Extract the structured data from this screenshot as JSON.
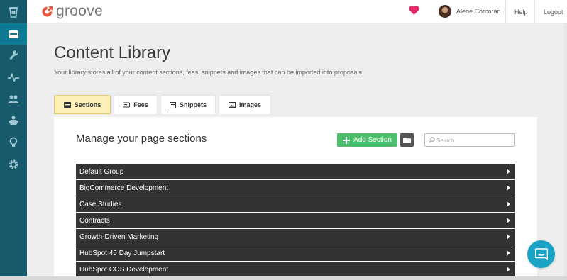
{
  "brand": {
    "name": "groove",
    "accent": "#e8573e",
    "sidebar_color": "#175a6b"
  },
  "sidebar": {
    "items": [
      {
        "icon": "cup-icon"
      },
      {
        "icon": "library-icon",
        "active": true
      },
      {
        "icon": "wrench-icon"
      },
      {
        "icon": "pulse-icon"
      },
      {
        "icon": "people-icon"
      },
      {
        "icon": "handshake-icon"
      },
      {
        "icon": "lightbulb-icon"
      },
      {
        "icon": "gear-icon"
      }
    ]
  },
  "topbar": {
    "user_name": "Alene Corcoran",
    "help": "Help",
    "logout": "Logout"
  },
  "page": {
    "title": "Content Library",
    "subtitle": "Your library stores all of your content sections, fees, snippets and images that can be imported into proposals."
  },
  "tabs": [
    {
      "label": "Sections",
      "icon": "sections-icon",
      "active": true
    },
    {
      "label": "Fees",
      "icon": "fees-icon"
    },
    {
      "label": "Snippets",
      "icon": "snippets-icon"
    },
    {
      "label": "Images",
      "icon": "images-icon"
    }
  ],
  "panel": {
    "title": "Manage your page sections",
    "add_button": "Add Section",
    "search_placeholder": "Search",
    "groups": [
      "Default Group",
      "BigCommerce Development",
      "Case Studies",
      "Contracts",
      "Growth-Driven Marketing",
      "HubSpot 45 Day Jumpstart",
      "HubSpot COS Development"
    ]
  }
}
